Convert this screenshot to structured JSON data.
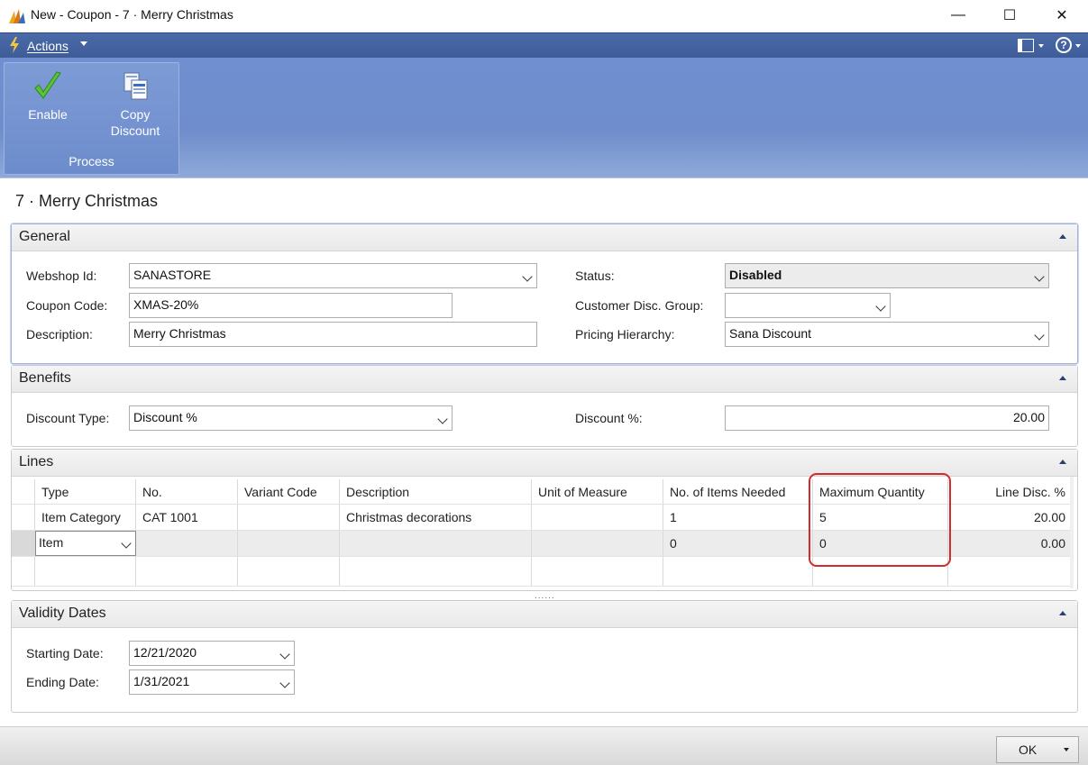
{
  "window": {
    "title": "New - Coupon - 7 · Merry Christmas",
    "minimize": "—",
    "maximize": "☐",
    "close": "✕"
  },
  "actions_bar": {
    "label": "Actions",
    "help": "?"
  },
  "ribbon": {
    "group_label": "Process",
    "enable_label": "Enable",
    "copy_label_1": "Copy",
    "copy_label_2": "Discount"
  },
  "page_title": "7 · Merry Christmas",
  "general": {
    "header": "General",
    "webshop_label": "Webshop Id:",
    "webshop_value": "SANASTORE",
    "coupon_label": "Coupon Code:",
    "coupon_value": "XMAS-20%",
    "description_label": "Description:",
    "description_value": "Merry Christmas",
    "status_label": "Status:",
    "status_value": "Disabled",
    "cust_group_label": "Customer Disc. Group:",
    "cust_group_value": "",
    "pricing_label": "Pricing Hierarchy:",
    "pricing_value": "Sana Discount"
  },
  "benefits": {
    "header": "Benefits",
    "discount_type_label": "Discount Type:",
    "discount_type_value": "Discount %",
    "discount_pct_label": "Discount %:",
    "discount_pct_value": "20.00"
  },
  "lines": {
    "header": "Lines",
    "columns": {
      "type": "Type",
      "no": "No.",
      "variant": "Variant Code",
      "description": "Description",
      "uom": "Unit of Measure",
      "items_needed": "No. of Items Needed",
      "max_qty": "Maximum Quantity",
      "line_disc": "Line Disc. %"
    },
    "rows": [
      {
        "type": "Item Category",
        "no": "CAT 1001",
        "variant": "",
        "description": "Christmas decorations",
        "uom": "",
        "items_needed": "1",
        "max_qty": "5",
        "line_disc": "20.00"
      },
      {
        "type": "Item",
        "no": "",
        "variant": "",
        "description": "",
        "uom": "",
        "items_needed": "0",
        "max_qty": "0",
        "line_disc": "0.00"
      }
    ],
    "grip": "......"
  },
  "validity": {
    "header": "Validity Dates",
    "start_label": "Starting Date:",
    "start_value": "12/21/2020",
    "end_label": "Ending Date:",
    "end_value": "1/31/2021"
  },
  "footer": {
    "ok_label": "OK"
  }
}
